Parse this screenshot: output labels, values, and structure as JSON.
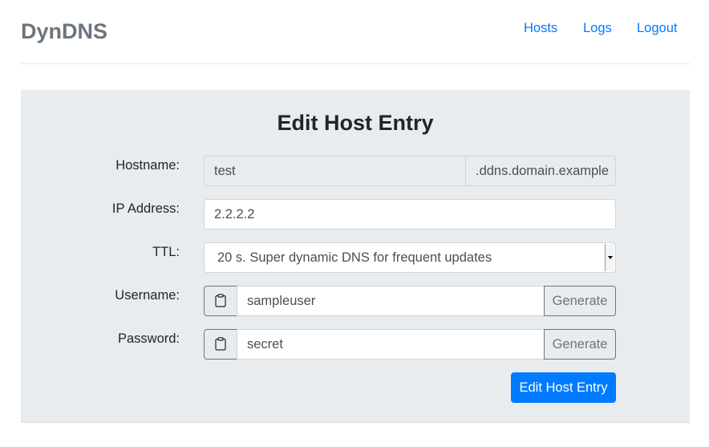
{
  "navbar": {
    "brand": "DynDNS",
    "links": [
      "Hosts",
      "Logs",
      "Logout"
    ]
  },
  "form": {
    "title": "Edit Host Entry",
    "hostname": {
      "label": "Hostname:",
      "value": "test",
      "suffix": ".ddns.domain.example"
    },
    "ip": {
      "label": "IP Address:",
      "value": "2.2.2.2"
    },
    "ttl": {
      "label": "TTL:",
      "selected": "20 s. Super dynamic DNS for frequent updates"
    },
    "username": {
      "label": "Username:",
      "value": "sampleuser",
      "generate_label": "Generate"
    },
    "password": {
      "label": "Password:",
      "value": "secret",
      "generate_label": "Generate"
    },
    "submit_label": "Edit Host Entry"
  },
  "colors": {
    "accent": "#007bff",
    "card_bg": "#e9ecef",
    "brand": "#6c757d"
  }
}
